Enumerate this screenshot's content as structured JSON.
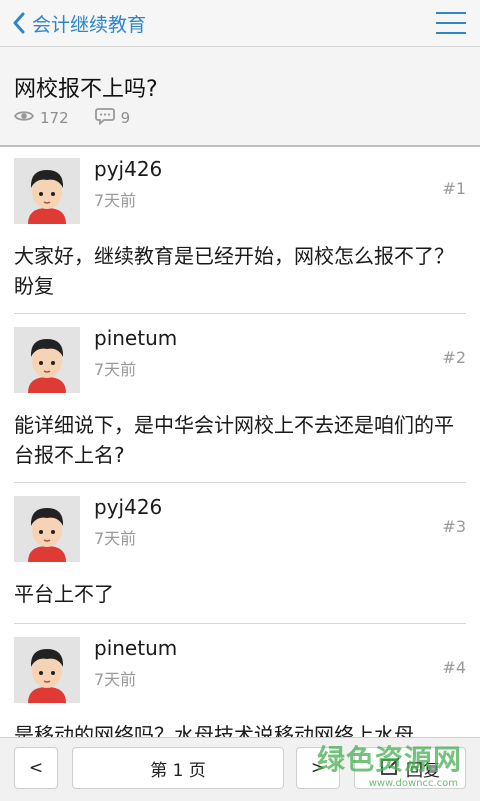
{
  "header": {
    "back_label": "会计继续教育"
  },
  "question": {
    "title": "网校报不上吗?",
    "views": "172",
    "comments": "9"
  },
  "posts": [
    {
      "user": "pyj426",
      "time": "7天前",
      "floor": "#1",
      "content": "大家好，继续教育是已经开始，网校怎么报不了？盼复"
    },
    {
      "user": "pinetum",
      "time": "7天前",
      "floor": "#2",
      "content": "能详细说下，是中华会计网校上不去还是咱们的平台报不上名?"
    },
    {
      "user": "pyj426",
      "time": "7天前",
      "floor": "#3",
      "content": "平台上不了"
    },
    {
      "user": "pinetum",
      "time": "7天前",
      "floor": "#4",
      "content": "是移动的网络吗？水母技术说移动网络上水母"
    }
  ],
  "pager": {
    "prev": "<",
    "page": "第 1 页",
    "next": ">",
    "reply": "回复"
  },
  "watermark": {
    "text": "绿色资源网",
    "url": "www.downcc.com"
  },
  "colors": {
    "accent": "#2e86c9",
    "watermark": "#46af50"
  }
}
